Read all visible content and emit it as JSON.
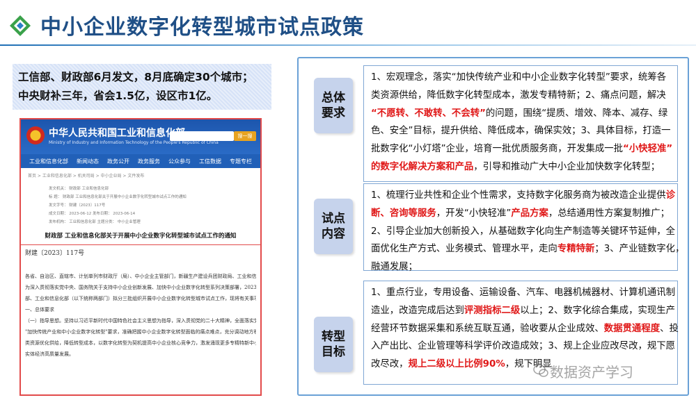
{
  "title": "中小企业数字化转型城市试点政策",
  "summary": {
    "line1": "工信部、财政部6月发文，8月底确定30个城市；",
    "line2": "中央财补三年，省会1.5亿，设区市1亿。"
  },
  "document": {
    "ministry_cn": "中华人民共和国工业和信息化部",
    "ministry_en": "Ministry of Industry and Information Technology of the People's Republic of China",
    "search_button": "搜一搜",
    "nav": [
      "工业和信息化部",
      "新闻动态",
      "政务公开",
      "政务服务",
      "公众参与",
      "工信数据",
      "专题专栏"
    ],
    "breadcrumb": "首页 > 工业和信息化部 > 机关司局 > 中小企业局 > 文件发布",
    "meta": [
      "发文机关：  财政部  工业和信息化部",
      "标      题：  财政部 工业和信息化部关于开展中小企业数字化转型城市试点工作的通知",
      "发文字号：  财建〔2023〕117号",
      "成文日期：  2023-06-12                    发布日期：  2023-06-14",
      "发布机构：  工业和信息化部                主题分类：  中小企业管理"
    ],
    "doc_title": "财政部 工业和信息化部关于开展中小企业数字化转型城市试点工作的通知",
    "doc_number": "财建〔2023〕117号",
    "body": [
      "各省、自治区、直辖市、计划单列市财政厅（局）、中小企业主管部门，新疆生产建设兵团财政局、工业和信息化局：",
      "为深入贯彻落实党中央、国务院关于支持中小企业创新发展、加快中小企业数字化转型系列决策部署，2023—2025年，财政",
      "部、工业和信息化部（以下统称两部门）拟分三批组织开展中小企业数字化转型城市试点工作，现将有关事项通知如下：",
      "一、总体要求",
      "（一）指导思想。坚持以习近平新时代中国特色社会主义思想为指导，深入贯彻党的二十大精神，全面落实党中央、国务院关于",
      "\"加快传统产业和中小企业数字化转型\"要求，准确把握中小企业数字化转型面临的痛点难点，充分调动地方积极性，统筹各",
      "类资源优化供给，降低转型成本，以数字化转型为契机提高中小企业核心竞争力，激发涌现更多专精特新中小企业，促进",
      "实体经济高质量发展。"
    ]
  },
  "sections": [
    {
      "label": "总体要求",
      "lines": [
        [
          {
            "t": "1、宏观理念，落实“加快传统产业和中小企业数字化转型”要求，统筹各"
          }
        ],
        [
          {
            "t": "类资源供给，降低数字化转型成本，激发专精特新；2、痛点问题，解决"
          }
        ],
        [
          {
            "t": "“不愿转、不敢转、不会转”",
            "red": true
          },
          {
            "t": "的问题，围绕“提质、增效、降本、减存、绿"
          }
        ],
        [
          {
            "t": "色、安全”目标，提升供给、降低成本，确保实效；3、具体目标，打造一"
          }
        ],
        [
          {
            "t": "批数字化“小灯塔”企业，培育一批优质服务商，开发集成一批"
          },
          {
            "t": "“小快轻准”",
            "red": true
          }
        ],
        [
          {
            "t": "的数字化解决方案和产品",
            "red": true
          },
          {
            "t": "，引导和推动广大中小企业加快数字化转型；"
          }
        ]
      ]
    },
    {
      "label": "试点内容",
      "lines": [
        [
          {
            "t": "1、梳理行业共性和企业个性需求，支持数字化服务商为被改造企业提供"
          },
          {
            "t": "诊",
            "red": true
          }
        ],
        [
          {
            "t": "断、咨询等服务",
            "red": true
          },
          {
            "t": "，开发“小快轻准”"
          },
          {
            "t": "产品方案",
            "red": true
          },
          {
            "t": "，总结通用性方案复制推广；"
          }
        ],
        [
          {
            "t": "2、引导企业加大创新投入，从基础数字化向生产制造等关键环节延伸，全"
          }
        ],
        [
          {
            "t": "面优化生产方式、业务模式、管理水平，走向"
          },
          {
            "t": "专精特新",
            "red": true
          },
          {
            "t": "；3、产业链数字化，"
          }
        ],
        [
          {
            "t": "融通发展；"
          }
        ]
      ]
    },
    {
      "label": "转型目标",
      "lines": [
        [
          {
            "t": "1、重点行业，专用设备、运输设备、汽车、电器机械器材、计算机通讯制"
          }
        ],
        [
          {
            "t": "造业，改造完成后达到"
          },
          {
            "t": "评测指标二级",
            "red": true
          },
          {
            "t": "以上；2、数字化综合集成，实现生产"
          }
        ],
        [
          {
            "t": "经营环节数据采集和系统互联互通，验收要从企业成效、"
          },
          {
            "t": "数据贯通程度",
            "red": true
          },
          {
            "t": "、投"
          }
        ],
        [
          {
            "t": "入产出比、企业管理等科学评价改造成效；3、规上企业应改尽改，规下愿"
          }
        ],
        [
          {
            "t": "改尽改，"
          },
          {
            "t": "规上二级以上比例90%",
            "red": true
          },
          {
            "t": "，规下明显"
          }
        ]
      ]
    }
  ],
  "watermark": "数据资产学习",
  "colors": {
    "title": "#1f4f86",
    "highlight": "#e01818",
    "label_bg": "#c6d3ec",
    "panel_border": "#6aa1d6"
  }
}
